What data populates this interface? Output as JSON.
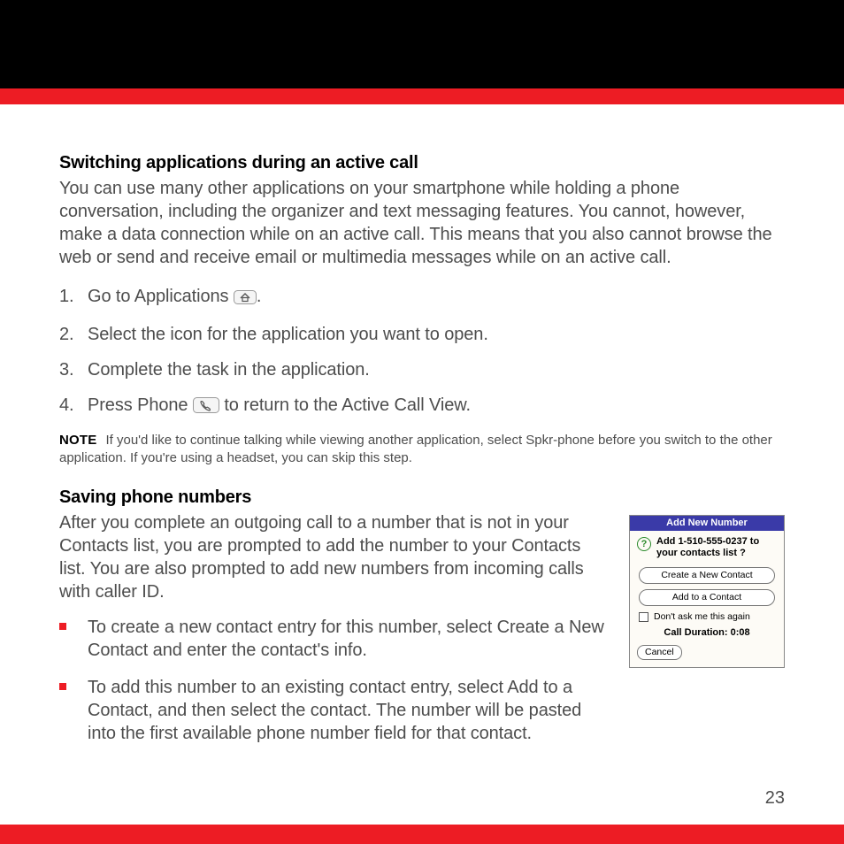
{
  "section1": {
    "heading": "Switching applications during an active call",
    "intro": "You can use many other applications on your smartphone while holding a phone conversation, including the organizer and text messaging features. You cannot, however, make a data connection while on an active call. This means that you also cannot browse the web or send and receive email or multimedia messages while on an active call.",
    "steps": {
      "s1a": "Go to Applications ",
      "s1b": ".",
      "s2": "Select the icon for the application you want to open.",
      "s3": "Complete the task in the application.",
      "s4a": "Press Phone ",
      "s4b": " to return to the Active Call View."
    },
    "note_label": "NOTE",
    "note_text": "If you'd like to continue talking while viewing another application, select Spkr-phone before you switch to the other application. If you're using a headset, you can skip this step."
  },
  "section2": {
    "heading": "Saving phone numbers",
    "intro": "After you complete an outgoing call to a number that is not in your Contacts list, you are prompted to add the number to your Contacts list. You are also prompted to add new numbers from incoming calls with caller ID.",
    "bullets": {
      "b1": "To create a new contact entry for this number, select Create a New Contact and enter the contact's info.",
      "b2": "To add this number to an existing contact entry, select Add to a Contact, and then select the contact. The number will be pasted into the first available phone number field for that contact."
    }
  },
  "dialog": {
    "title": "Add New Number",
    "prompt": "Add 1-510-555-0237 to your contacts list ?",
    "btn_create": "Create a New Contact",
    "btn_add": "Add to a Contact",
    "dont_ask": "Don't ask me this again",
    "duration": "Call Duration: 0:08",
    "cancel": "Cancel"
  },
  "page_number": "23"
}
